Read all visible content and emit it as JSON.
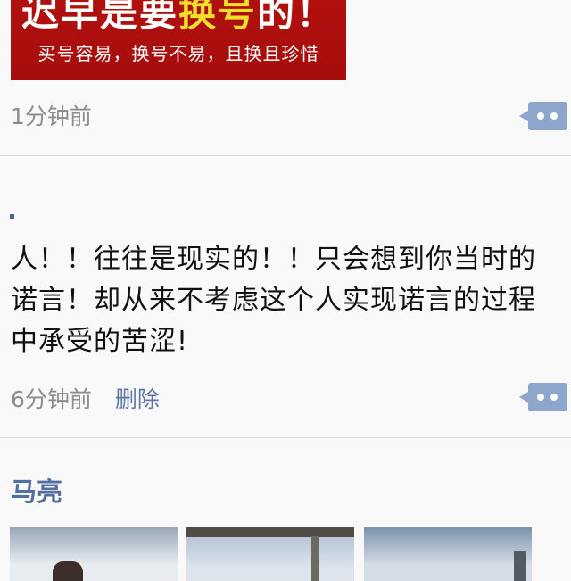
{
  "posts": [
    {
      "banner": {
        "headline_pre": "迟早是要",
        "headline_accent": "换号",
        "headline_post": "的！",
        "subline": "买号容易，换号不易，且换且珍惜"
      },
      "time": "1分钟前",
      "comment_icon": "speech-bubble-ellipsis-icon"
    },
    {
      "text": "人！！往往是现实的！！只会想到你当时的诺言！却从来不考虑这个人实现诺言的过程中承受的苦涩!",
      "time": "6分钟前",
      "delete_label": "删除",
      "comment_icon": "speech-bubble-ellipsis-icon"
    },
    {
      "author": "马亮",
      "photos": [
        "photo-1",
        "photo-2",
        "photo-3"
      ]
    }
  ],
  "colors": {
    "link_blue": "#5d77a4",
    "banner_red": "#b3120f",
    "banner_accent": "#f2df2a",
    "comment_button": "#8fa6cc",
    "time_gray": "#8c8c8c"
  }
}
